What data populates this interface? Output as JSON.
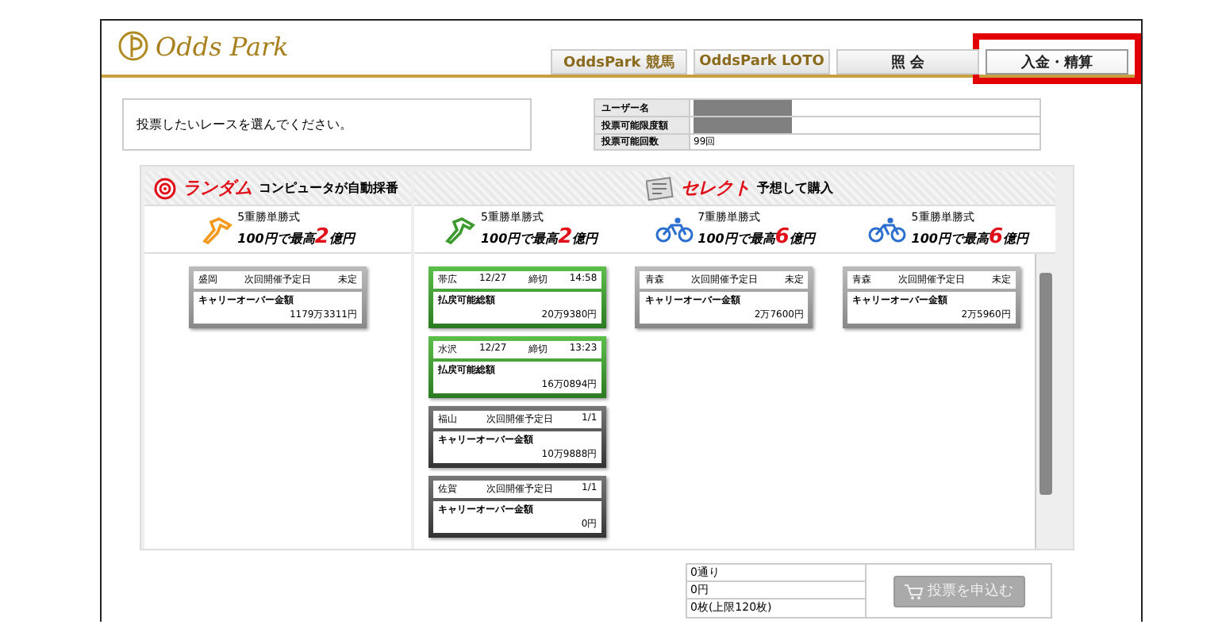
{
  "logo": {
    "text": "Odds Park"
  },
  "nav": [
    {
      "label": "OddsPark 競馬",
      "kind": "brand",
      "selected": false
    },
    {
      "label": "OddsPark LOTO",
      "kind": "brand",
      "selected": false
    },
    {
      "label": "照 会",
      "kind": "plain",
      "selected": false
    },
    {
      "label": "入金・精算",
      "kind": "plain",
      "selected": true
    }
  ],
  "message": "投票したいレースを選んでください。",
  "account": [
    {
      "label": "ユーザー名",
      "redacted": true
    },
    {
      "label": "投票可能限度額",
      "redacted": true
    },
    {
      "label": "投票可能回数",
      "value": "99回",
      "redacted": false
    }
  ],
  "random": {
    "title": "ランダム",
    "subtitle": "コンピュータが自動採番",
    "columns": [
      {
        "kind": "horse",
        "color": "#f39a1e",
        "bet": "5重勝単勝式",
        "prefix": "100円で最高",
        "highlight": "2",
        "suffix": "億円",
        "cards": [
          {
            "kind": "pending",
            "venue": "盛岡",
            "label": "次回開催予定日",
            "status": "未定",
            "amount_label": "キャリーオーバー金額",
            "amount": "1179万3311円"
          }
        ]
      }
    ]
  },
  "select": {
    "title": "セレクト",
    "subtitle": "予想して購入",
    "columns": [
      {
        "kind": "horse",
        "color": "#3c9a2e",
        "bet": "5重勝単勝式",
        "prefix": "100円で最高",
        "highlight": "2",
        "suffix": "億円",
        "cards": [
          {
            "kind": "open",
            "venue": "帯広",
            "label": "締切",
            "date": "12/27",
            "status": "14:58",
            "amount_label": "払戻可能総額",
            "amount": "20万9380円"
          },
          {
            "kind": "open",
            "venue": "水沢",
            "label": "締切",
            "date": "12/27",
            "status": "13:23",
            "amount_label": "払戻可能総額",
            "amount": "16万0894円"
          },
          {
            "kind": "closed",
            "venue": "福山",
            "label": "次回開催予定日",
            "status": "1/1",
            "amount_label": "キャリーオーバー金額",
            "amount": "10万9888円"
          },
          {
            "kind": "closed",
            "venue": "佐賀",
            "label": "次回開催予定日",
            "status": "1/1",
            "amount_label": "キャリーオーバー金額",
            "amount": "0円"
          }
        ]
      },
      {
        "kind": "bike",
        "color": "#2a6fd0",
        "bet": "7重勝単勝式",
        "prefix": "100円で最高",
        "highlight": "6",
        "suffix": "億円",
        "cards": [
          {
            "kind": "pending",
            "venue": "青森",
            "label": "次回開催予定日",
            "status": "未定",
            "amount_label": "キャリーオーバー金額",
            "amount": "2万7600円"
          }
        ]
      },
      {
        "kind": "bike",
        "color": "#2a6fd0",
        "bet": "5重勝単勝式",
        "prefix": "100円で最高",
        "highlight": "6",
        "suffix": "億円",
        "cards": [
          {
            "kind": "pending",
            "venue": "青森",
            "label": "次回開催予定日",
            "status": "未定",
            "amount_label": "キャリーオーバー金額",
            "amount": "2万5960円"
          }
        ]
      }
    ]
  },
  "summary": [
    "0通り",
    "0円",
    "0枚(上限120枚)"
  ],
  "submit": {
    "label": "投票を申込む",
    "disabled": true
  }
}
